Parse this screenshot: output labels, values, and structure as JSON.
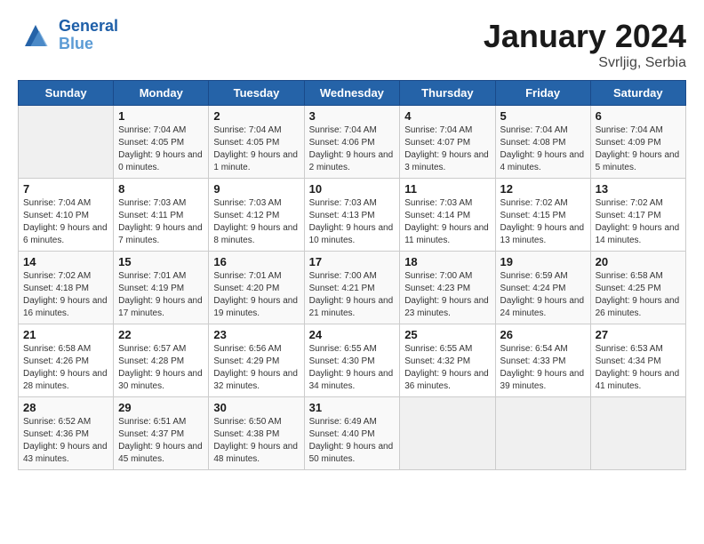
{
  "header": {
    "logo_line1": "General",
    "logo_line2": "Blue",
    "title": "January 2024",
    "subtitle": "Svrljig, Serbia"
  },
  "weekdays": [
    "Sunday",
    "Monday",
    "Tuesday",
    "Wednesday",
    "Thursday",
    "Friday",
    "Saturday"
  ],
  "weeks": [
    [
      {
        "day": "",
        "sunrise": "",
        "sunset": "",
        "daylight": ""
      },
      {
        "day": "1",
        "sunrise": "Sunrise: 7:04 AM",
        "sunset": "Sunset: 4:05 PM",
        "daylight": "Daylight: 9 hours and 0 minutes."
      },
      {
        "day": "2",
        "sunrise": "Sunrise: 7:04 AM",
        "sunset": "Sunset: 4:05 PM",
        "daylight": "Daylight: 9 hours and 1 minute."
      },
      {
        "day": "3",
        "sunrise": "Sunrise: 7:04 AM",
        "sunset": "Sunset: 4:06 PM",
        "daylight": "Daylight: 9 hours and 2 minutes."
      },
      {
        "day": "4",
        "sunrise": "Sunrise: 7:04 AM",
        "sunset": "Sunset: 4:07 PM",
        "daylight": "Daylight: 9 hours and 3 minutes."
      },
      {
        "day": "5",
        "sunrise": "Sunrise: 7:04 AM",
        "sunset": "Sunset: 4:08 PM",
        "daylight": "Daylight: 9 hours and 4 minutes."
      },
      {
        "day": "6",
        "sunrise": "Sunrise: 7:04 AM",
        "sunset": "Sunset: 4:09 PM",
        "daylight": "Daylight: 9 hours and 5 minutes."
      }
    ],
    [
      {
        "day": "7",
        "sunrise": "Sunrise: 7:04 AM",
        "sunset": "Sunset: 4:10 PM",
        "daylight": "Daylight: 9 hours and 6 minutes."
      },
      {
        "day": "8",
        "sunrise": "Sunrise: 7:03 AM",
        "sunset": "Sunset: 4:11 PM",
        "daylight": "Daylight: 9 hours and 7 minutes."
      },
      {
        "day": "9",
        "sunrise": "Sunrise: 7:03 AM",
        "sunset": "Sunset: 4:12 PM",
        "daylight": "Daylight: 9 hours and 8 minutes."
      },
      {
        "day": "10",
        "sunrise": "Sunrise: 7:03 AM",
        "sunset": "Sunset: 4:13 PM",
        "daylight": "Daylight: 9 hours and 10 minutes."
      },
      {
        "day": "11",
        "sunrise": "Sunrise: 7:03 AM",
        "sunset": "Sunset: 4:14 PM",
        "daylight": "Daylight: 9 hours and 11 minutes."
      },
      {
        "day": "12",
        "sunrise": "Sunrise: 7:02 AM",
        "sunset": "Sunset: 4:15 PM",
        "daylight": "Daylight: 9 hours and 13 minutes."
      },
      {
        "day": "13",
        "sunrise": "Sunrise: 7:02 AM",
        "sunset": "Sunset: 4:17 PM",
        "daylight": "Daylight: 9 hours and 14 minutes."
      }
    ],
    [
      {
        "day": "14",
        "sunrise": "Sunrise: 7:02 AM",
        "sunset": "Sunset: 4:18 PM",
        "daylight": "Daylight: 9 hours and 16 minutes."
      },
      {
        "day": "15",
        "sunrise": "Sunrise: 7:01 AM",
        "sunset": "Sunset: 4:19 PM",
        "daylight": "Daylight: 9 hours and 17 minutes."
      },
      {
        "day": "16",
        "sunrise": "Sunrise: 7:01 AM",
        "sunset": "Sunset: 4:20 PM",
        "daylight": "Daylight: 9 hours and 19 minutes."
      },
      {
        "day": "17",
        "sunrise": "Sunrise: 7:00 AM",
        "sunset": "Sunset: 4:21 PM",
        "daylight": "Daylight: 9 hours and 21 minutes."
      },
      {
        "day": "18",
        "sunrise": "Sunrise: 7:00 AM",
        "sunset": "Sunset: 4:23 PM",
        "daylight": "Daylight: 9 hours and 23 minutes."
      },
      {
        "day": "19",
        "sunrise": "Sunrise: 6:59 AM",
        "sunset": "Sunset: 4:24 PM",
        "daylight": "Daylight: 9 hours and 24 minutes."
      },
      {
        "day": "20",
        "sunrise": "Sunrise: 6:58 AM",
        "sunset": "Sunset: 4:25 PM",
        "daylight": "Daylight: 9 hours and 26 minutes."
      }
    ],
    [
      {
        "day": "21",
        "sunrise": "Sunrise: 6:58 AM",
        "sunset": "Sunset: 4:26 PM",
        "daylight": "Daylight: 9 hours and 28 minutes."
      },
      {
        "day": "22",
        "sunrise": "Sunrise: 6:57 AM",
        "sunset": "Sunset: 4:28 PM",
        "daylight": "Daylight: 9 hours and 30 minutes."
      },
      {
        "day": "23",
        "sunrise": "Sunrise: 6:56 AM",
        "sunset": "Sunset: 4:29 PM",
        "daylight": "Daylight: 9 hours and 32 minutes."
      },
      {
        "day": "24",
        "sunrise": "Sunrise: 6:55 AM",
        "sunset": "Sunset: 4:30 PM",
        "daylight": "Daylight: 9 hours and 34 minutes."
      },
      {
        "day": "25",
        "sunrise": "Sunrise: 6:55 AM",
        "sunset": "Sunset: 4:32 PM",
        "daylight": "Daylight: 9 hours and 36 minutes."
      },
      {
        "day": "26",
        "sunrise": "Sunrise: 6:54 AM",
        "sunset": "Sunset: 4:33 PM",
        "daylight": "Daylight: 9 hours and 39 minutes."
      },
      {
        "day": "27",
        "sunrise": "Sunrise: 6:53 AM",
        "sunset": "Sunset: 4:34 PM",
        "daylight": "Daylight: 9 hours and 41 minutes."
      }
    ],
    [
      {
        "day": "28",
        "sunrise": "Sunrise: 6:52 AM",
        "sunset": "Sunset: 4:36 PM",
        "daylight": "Daylight: 9 hours and 43 minutes."
      },
      {
        "day": "29",
        "sunrise": "Sunrise: 6:51 AM",
        "sunset": "Sunset: 4:37 PM",
        "daylight": "Daylight: 9 hours and 45 minutes."
      },
      {
        "day": "30",
        "sunrise": "Sunrise: 6:50 AM",
        "sunset": "Sunset: 4:38 PM",
        "daylight": "Daylight: 9 hours and 48 minutes."
      },
      {
        "day": "31",
        "sunrise": "Sunrise: 6:49 AM",
        "sunset": "Sunset: 4:40 PM",
        "daylight": "Daylight: 9 hours and 50 minutes."
      },
      {
        "day": "",
        "sunrise": "",
        "sunset": "",
        "daylight": ""
      },
      {
        "day": "",
        "sunrise": "",
        "sunset": "",
        "daylight": ""
      },
      {
        "day": "",
        "sunrise": "",
        "sunset": "",
        "daylight": ""
      }
    ]
  ]
}
